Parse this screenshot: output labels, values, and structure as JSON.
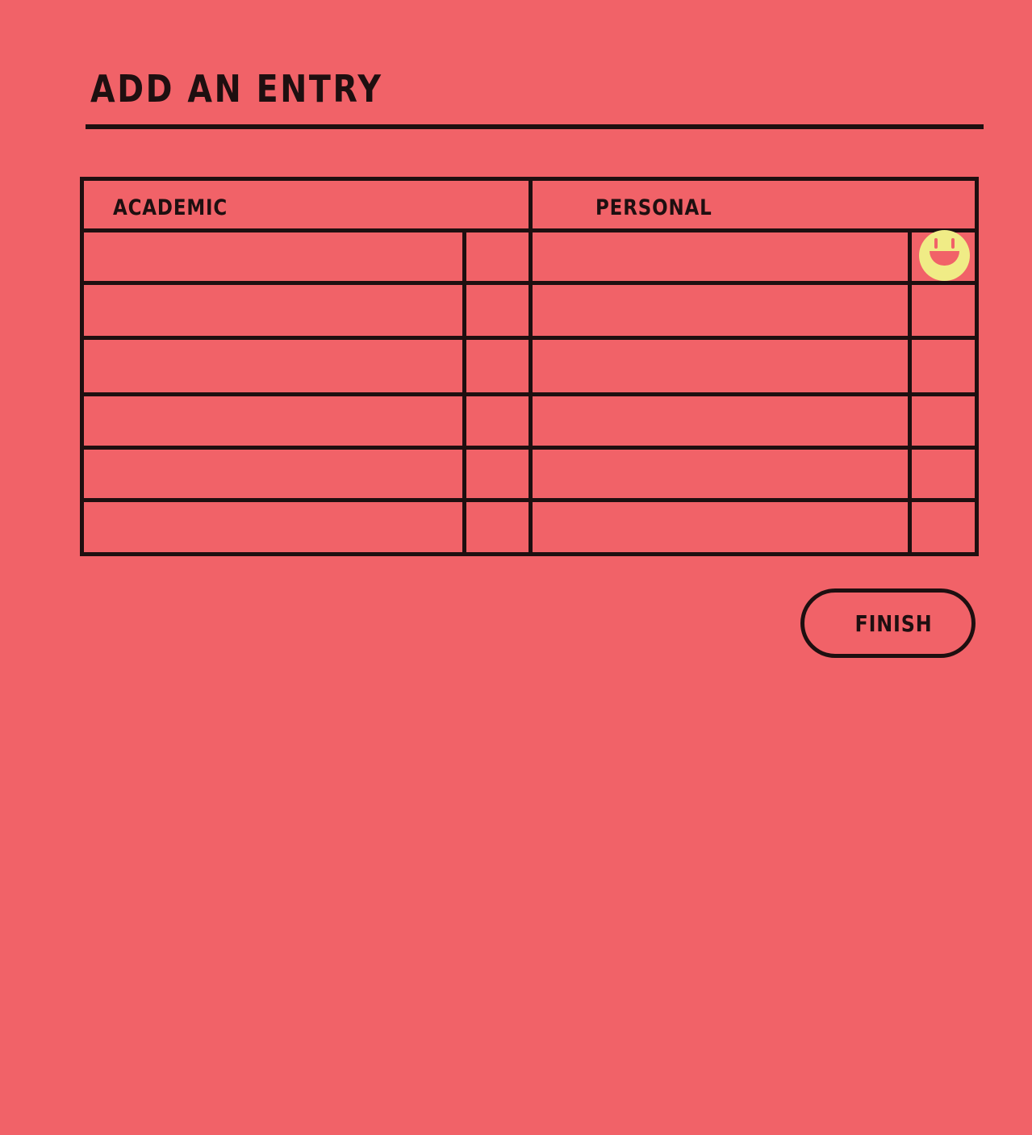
{
  "page": {
    "title": "ADD AN ENTRY"
  },
  "table": {
    "academic_header": "ACADEMIC",
    "personal_header": "PERSONAL",
    "row_count": 6,
    "rows": [
      {
        "academic_entry": "",
        "academic_value": "",
        "personal_entry": "",
        "personal_value": ""
      },
      {
        "academic_entry": "",
        "academic_value": "",
        "personal_entry": "",
        "personal_value": ""
      },
      {
        "academic_entry": "",
        "academic_value": "",
        "personal_entry": "",
        "personal_value": ""
      },
      {
        "academic_entry": "",
        "academic_value": "",
        "personal_entry": "",
        "personal_value": ""
      },
      {
        "academic_entry": "",
        "academic_value": "",
        "personal_entry": "",
        "personal_value": ""
      },
      {
        "academic_entry": "",
        "academic_value": "",
        "personal_entry": "",
        "personal_value": ""
      }
    ]
  },
  "mood_icon": {
    "icon": "smiley-face-icon",
    "color": "#F0EC86"
  },
  "actions": {
    "finish_label": "FINISH"
  },
  "colors": {
    "background": "#F16268",
    "ink": "#1E0F10",
    "accent": "#F0EC86"
  }
}
